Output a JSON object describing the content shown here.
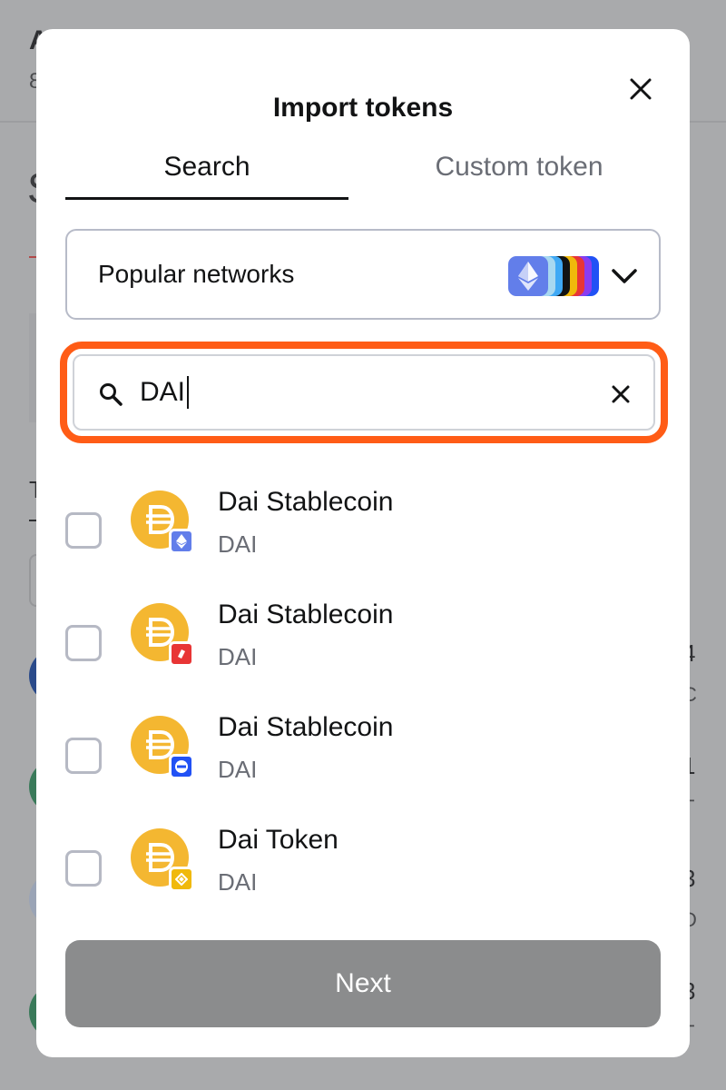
{
  "background": {
    "fragments": [
      "A",
      "8",
      "S",
      "T",
      "4",
      "C",
      "1",
      "T",
      "3",
      "D",
      "3",
      "T"
    ]
  },
  "modal": {
    "title": "Import tokens",
    "close_icon": "close-icon"
  },
  "tabs": [
    {
      "label": "Search",
      "active": true
    },
    {
      "label": "Custom token",
      "active": false
    }
  ],
  "network_select": {
    "label": "Popular networks",
    "icons": [
      "ethereum-icon",
      "network-stack-icon"
    ],
    "chevron": "chevron-down-icon"
  },
  "search": {
    "value": "DAI",
    "icon": "search-icon",
    "clear_icon": "clear-icon"
  },
  "tokens": [
    {
      "name": "Dai Stablecoin",
      "symbol": "DAI",
      "network_badge": "ethereum-badge-icon",
      "badge_color": "#627eea",
      "checked": false
    },
    {
      "name": "Dai Stablecoin",
      "symbol": "DAI",
      "network_badge": "optimism-badge-icon",
      "badge_color": "#e83535",
      "checked": false
    },
    {
      "name": "Dai Stablecoin",
      "symbol": "DAI",
      "network_badge": "base-badge-icon",
      "badge_color": "#2151f5",
      "checked": false
    },
    {
      "name": "Dai Token",
      "symbol": "DAI",
      "network_badge": "bnb-badge-icon",
      "badge_color": "#f0b90b",
      "checked": false
    }
  ],
  "next_button": {
    "label": "Next",
    "enabled": false
  },
  "colors": {
    "accent_focus": "#ff5c16",
    "dai_gold": "#f4b731",
    "disabled_button": "#8b8c8d",
    "text_primary": "#121314",
    "text_muted": "#6a6d75"
  }
}
